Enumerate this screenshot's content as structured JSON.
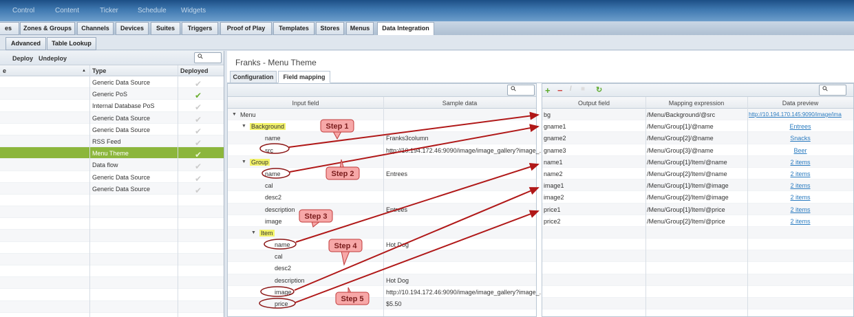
{
  "topnav": [
    "Control",
    "Content",
    "Ticker",
    "Schedule",
    "Widgets"
  ],
  "main_tabs": [
    "es",
    "Zones & Groups",
    "Channels",
    "Devices",
    "Suites",
    "Triggers",
    "Proof of Play",
    "Templates",
    "Stores",
    "Menus",
    "Data Integration"
  ],
  "sub_tabs": [
    "Advanced",
    "Table Lookup"
  ],
  "left": {
    "toolbar": [
      "Deploy",
      "Undeploy"
    ],
    "headers": {
      "name": "e",
      "type": "Type",
      "deployed": "Deployed"
    },
    "rows": [
      {
        "type": "Generic Data Source",
        "deployed": false
      },
      {
        "type": "Generic PoS",
        "deployed": true
      },
      {
        "type": "Internal Database PoS",
        "deployed": false
      },
      {
        "type": "Generic Data Source",
        "deployed": false
      },
      {
        "type": "Generic Data Source",
        "deployed": false
      },
      {
        "type": "RSS Feed",
        "deployed": false
      },
      {
        "type": "Menu Theme",
        "deployed": false,
        "selected": true
      },
      {
        "type": "Data flow",
        "deployed": false
      },
      {
        "type": "Generic Data Source",
        "deployed": false
      },
      {
        "type": "Generic Data Source",
        "deployed": false
      }
    ]
  },
  "right": {
    "title": "Franks - Menu Theme",
    "tabs": [
      "Configuration",
      "Field mapping"
    ],
    "input": {
      "headers": [
        "Input field",
        "Sample data"
      ],
      "rows": [
        {
          "f": "Menu",
          "d": "",
          "lvl": 0,
          "tri": true
        },
        {
          "f": "Background",
          "d": "",
          "lvl": 1,
          "tri": true,
          "hl": true
        },
        {
          "f": "name",
          "d": "Franks3column",
          "lvl": 2
        },
        {
          "f": "src",
          "d": "http://10.194.172.46:9090/image/image_gallery?image_...",
          "lvl": 2
        },
        {
          "f": "Group",
          "d": "",
          "lvl": 1,
          "tri": true,
          "hl": true
        },
        {
          "f": "name",
          "d": "Entrees",
          "lvl": 2
        },
        {
          "f": "cal",
          "d": "",
          "lvl": 2
        },
        {
          "f": "desc2",
          "d": "",
          "lvl": 2
        },
        {
          "f": "description",
          "d": "Entrees",
          "lvl": 2
        },
        {
          "f": "image",
          "d": "",
          "lvl": 2
        },
        {
          "f": "Item",
          "d": "",
          "lvl": 2,
          "tri": true,
          "hl": true
        },
        {
          "f": "name",
          "d": "Hot Dog",
          "lvl": 3
        },
        {
          "f": "cal",
          "d": "",
          "lvl": 3
        },
        {
          "f": "desc2",
          "d": "",
          "lvl": 3
        },
        {
          "f": "description",
          "d": "Hot Dog",
          "lvl": 3
        },
        {
          "f": "image",
          "d": "http://10.194.172.46:9090/image/image_gallery?image_...",
          "lvl": 3
        },
        {
          "f": "price",
          "d": "$5.50",
          "lvl": 3
        }
      ]
    },
    "output": {
      "headers": [
        "Output field",
        "Mapping expression",
        "Data preview"
      ],
      "rows": [
        [
          "bg",
          "/Menu/Background/@src",
          "http://10.194.170.145:9090/image/ima"
        ],
        [
          "gname1",
          "/Menu/Group[1]/@name",
          "Entrees"
        ],
        [
          "gname2",
          "/Menu/Group[2]/@name",
          "Snacks"
        ],
        [
          "gname3",
          "/Menu/Group[3]/@name",
          "Beer"
        ],
        [
          "name1",
          "/Menu/Group[1]/Item/@name",
          "2 items"
        ],
        [
          "name2",
          "/Menu/Group[2]/Item/@name",
          "2 items"
        ],
        [
          "image1",
          "/Menu/Group[1]/Item/@image",
          "2 items"
        ],
        [
          "image2",
          "/Menu/Group[2]/Item/@image",
          "2 items"
        ],
        [
          "price1",
          "/Menu/Group[1]/Item/@price",
          "2 items"
        ],
        [
          "price2",
          "/Menu/Group[2]/Item/@price",
          "2 items"
        ]
      ]
    }
  },
  "steps": [
    "Step 1",
    "Step 2",
    "Step 3",
    "Step 4",
    "Step 5"
  ],
  "colors": {
    "selected": "#8cb63c",
    "arrow": "#b01818",
    "highlight": "#f3f36a"
  }
}
